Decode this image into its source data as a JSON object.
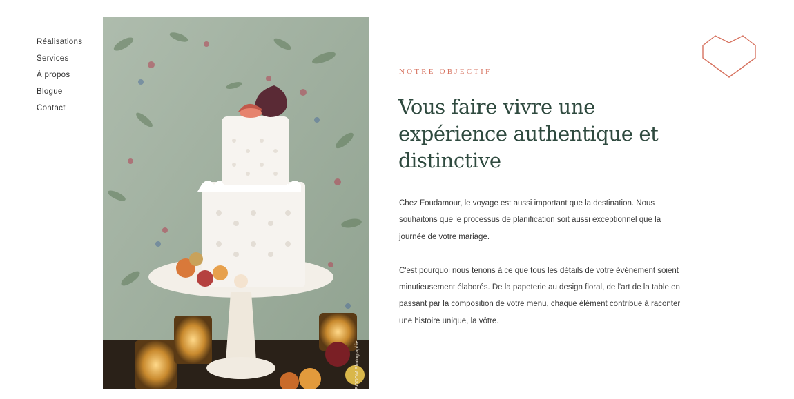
{
  "nav": {
    "items": [
      {
        "label": "Réalisations"
      },
      {
        "label": "Services"
      },
      {
        "label": "À propos"
      },
      {
        "label": "Blogue"
      },
      {
        "label": "Contact"
      }
    ]
  },
  "hero": {
    "photo_credit": "BOOOM Photographie"
  },
  "content": {
    "eyebrow": "NOTRE OBJECTIF",
    "headline": "Vous faire vivre une expérience authentique et distinctive",
    "paragraphs": [
      "Chez Foudamour, le voyage est aussi important que la destination. Nous souhaitons que le processus de planification soit aussi exceptionnel que la journée de votre mariage.",
      "C'est pourquoi nous tenons à ce que tous les détails de votre événement soient minutieusement élaborés. De la papeterie au design floral, de l'art de la table en passant par la composition de votre menu, chaque élément contribue à raconter une histoire unique, la vôtre."
    ]
  },
  "colors": {
    "accent": "#d77360",
    "headline": "#2f4a3f",
    "text": "#3a3a3a"
  },
  "icons": {
    "logo": "heart-outline-icon"
  }
}
